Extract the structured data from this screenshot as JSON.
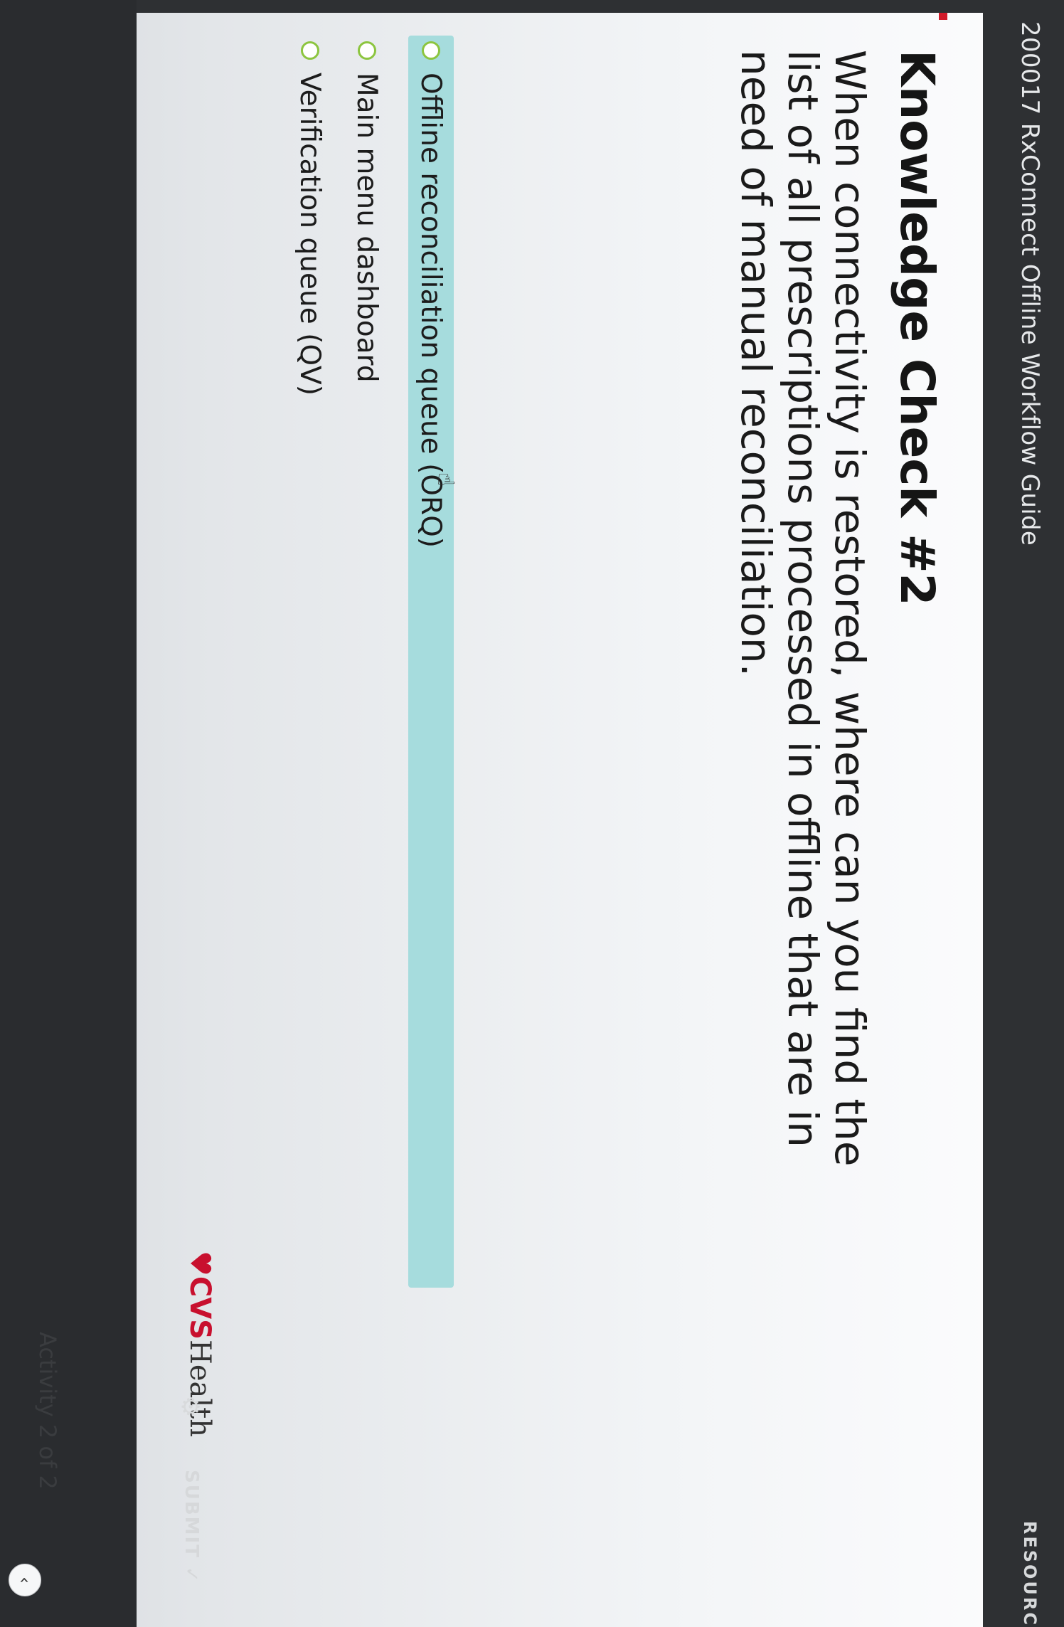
{
  "header": {
    "course_title": "200017 RxConnect Offline Workflow Guide",
    "resources_label": "RESOURC"
  },
  "main": {
    "heading": "Knowledge Check #2",
    "question": "When connectivity is restored, where can you find the list of all prescriptions processed in offline that are in need of manual reconciliation.",
    "options": [
      {
        "label": "Offline reconciliation queue (ORQ)",
        "selected": true
      },
      {
        "label": "Main menu dashboard",
        "selected": false
      },
      {
        "label": "Verification queue (QV)",
        "selected": false
      }
    ]
  },
  "footer": {
    "logo_brand": "CVS",
    "logo_health": "Health",
    "submit_label": "SUBMIT",
    "activity_counter": "Activity 2 of 2"
  },
  "icons": {
    "heart": "heart-icon",
    "gear": "gear-icon",
    "check": "check-icon",
    "prev": "chevron-left-icon",
    "cursor": "hand-pointer-icon"
  },
  "colors": {
    "brand_red": "#c8102e",
    "selection": "#a6dcdd",
    "radio_border": "#8cc53f",
    "dark_bar": "#2e3033"
  }
}
